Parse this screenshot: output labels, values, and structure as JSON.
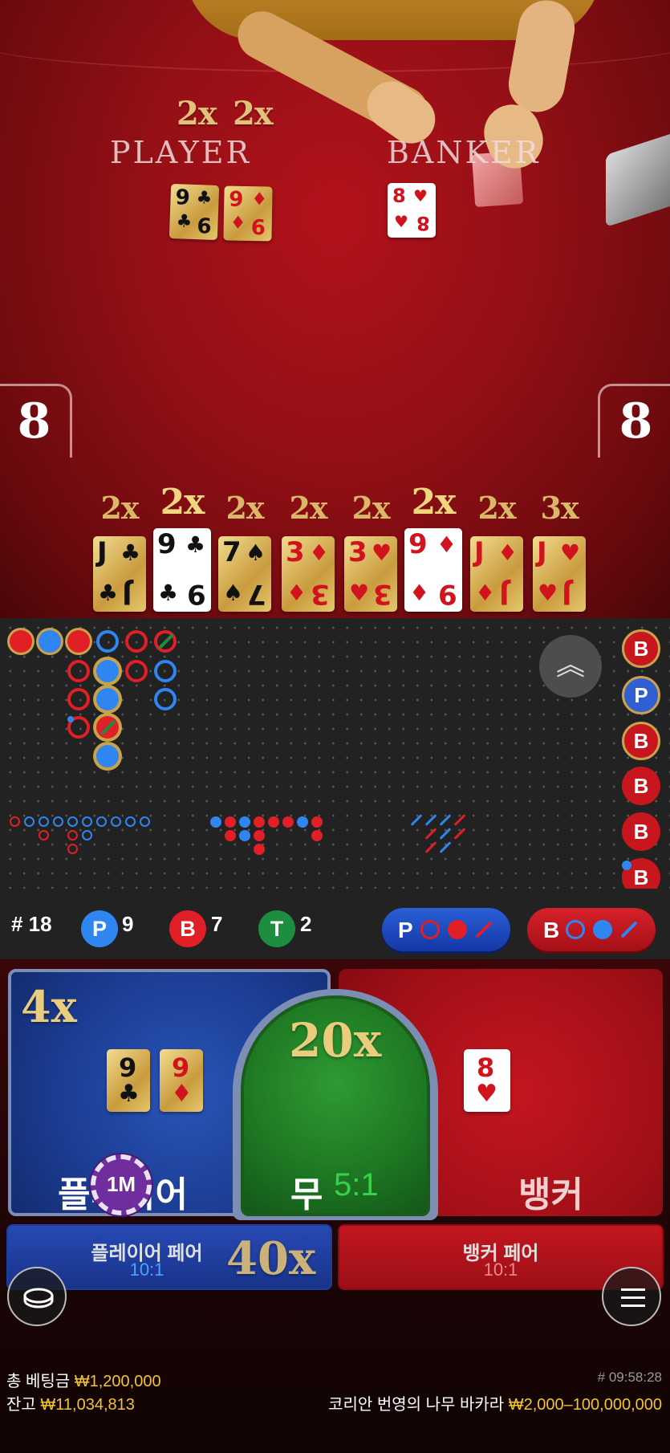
{
  "table": {
    "player_label": "PLAYER",
    "banker_label": "BANKER",
    "player_multipliers": [
      "2x",
      "2x"
    ],
    "player_score": "8",
    "banker_score": "8",
    "player_cards": [
      {
        "rank": "9",
        "suit": "♣",
        "color": "black"
      },
      {
        "rank": "9",
        "suit": "♦",
        "color": "red"
      }
    ],
    "banker_cards": [
      {
        "rank": "8",
        "suit": "♥",
        "color": "red"
      }
    ]
  },
  "scoreboard": {
    "multipliers": [
      "2x",
      "2x",
      "2x",
      "2x",
      "2x",
      "2x",
      "2x",
      "3x"
    ],
    "cards": [
      {
        "rank": "J",
        "suit": "♣",
        "color": "black",
        "style": "gold"
      },
      {
        "rank": "9",
        "suit": "♣",
        "color": "black",
        "style": "white"
      },
      {
        "rank": "7",
        "suit": "♠",
        "color": "black",
        "style": "gold"
      },
      {
        "rank": "3",
        "suit": "♦",
        "color": "red",
        "style": "gold"
      },
      {
        "rank": "3",
        "suit": "♥",
        "color": "red",
        "style": "gold"
      },
      {
        "rank": "9",
        "suit": "♦",
        "color": "red",
        "style": "white"
      },
      {
        "rank": "J",
        "suit": "♦",
        "color": "red",
        "style": "gold"
      },
      {
        "rank": "J",
        "suit": "♥",
        "color": "red",
        "style": "gold"
      }
    ]
  },
  "roadmap": {
    "collapse_icon": "chevron-up-double-icon",
    "side_results": [
      "B",
      "P",
      "B",
      "B",
      "B",
      "B"
    ],
    "round_label": "# 18",
    "player_badge": "P",
    "player_count": "9",
    "banker_badge": "B",
    "banker_count": "7",
    "tie_badge": "T",
    "tie_count": "2",
    "player_ask_label": "P",
    "banker_ask_label": "B"
  },
  "bets": {
    "player": {
      "multiplier": "4x",
      "label": "플레이어",
      "cards": [
        {
          "rank": "9",
          "suit": "♣",
          "color": "black"
        },
        {
          "rank": "9",
          "suit": "♦",
          "color": "red"
        }
      ],
      "chip": "1M"
    },
    "tie": {
      "multiplier": "20x",
      "label": "무",
      "payout": "5:1"
    },
    "banker": {
      "label": "뱅커",
      "card": {
        "rank": "8",
        "suit": "♥",
        "color": "red"
      }
    },
    "player_pair": {
      "label": "플레이어 페어",
      "payout": "10:1",
      "multiplier": "40x"
    },
    "banker_pair": {
      "label": "뱅커 페어",
      "payout": "10:1"
    }
  },
  "footer": {
    "total_bet_label": "총 베팅금",
    "total_bet_value": "₩1,200,000",
    "balance_label": "잔고",
    "balance_value": "₩11,034,813",
    "game_id": "# 09:58:28",
    "table_name": "코리안 번영의 나무 바카라",
    "bet_limits": "₩2,000–100,000,000"
  },
  "colors": {
    "player_blue": "#2f86f0",
    "banker_red": "#e01f26",
    "tie_green": "#1d8d3f",
    "gold": "#f2c430"
  }
}
